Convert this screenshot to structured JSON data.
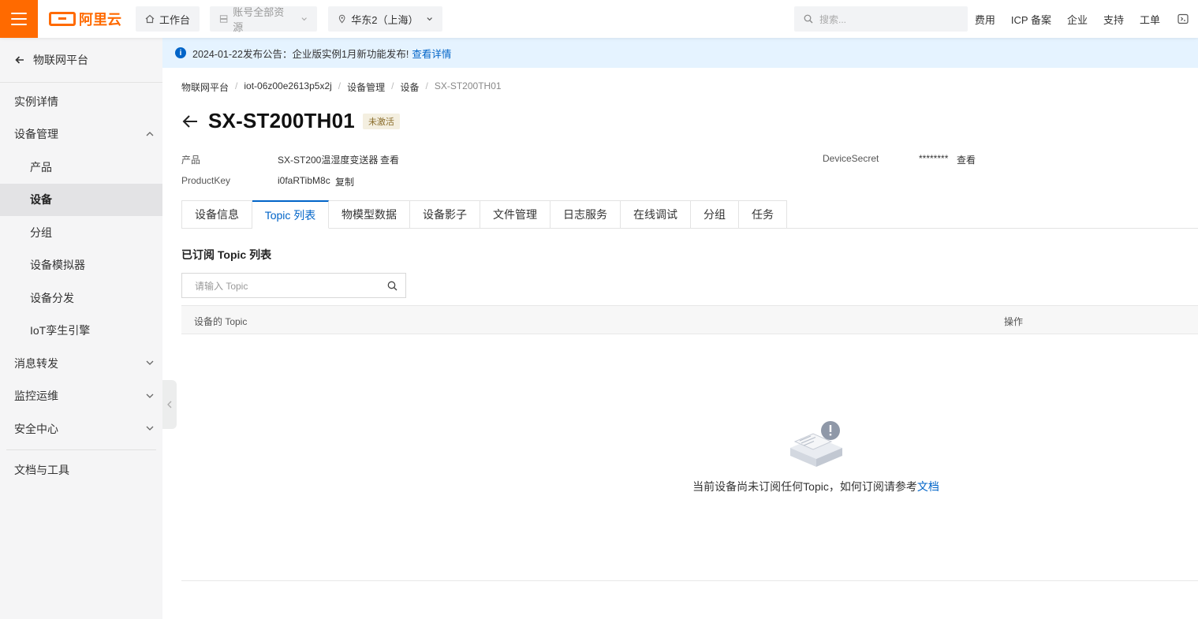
{
  "brand": {
    "logo_text": "阿里云",
    "accent": "#ff6a00",
    "link_color": "#0064c8"
  },
  "topbar": {
    "workbench": "工作台",
    "resources": "账号全部资源",
    "region": "华东2（上海）",
    "search_placeholder": "搜索...",
    "links": [
      "费用",
      "ICP 备案",
      "企业",
      "支持",
      "工单"
    ]
  },
  "sidebar": {
    "back_label": "物联网平台",
    "items": [
      {
        "label": "实例详情"
      },
      {
        "label": "设备管理"
      },
      {
        "label": "产品"
      },
      {
        "label": "设备"
      },
      {
        "label": "分组"
      },
      {
        "label": "设备模拟器"
      },
      {
        "label": "设备分发"
      },
      {
        "label": "IoT孪生引擎"
      },
      {
        "label": "消息转发"
      },
      {
        "label": "监控运维"
      },
      {
        "label": "安全中心"
      },
      {
        "label": "文档与工具"
      }
    ]
  },
  "notice": {
    "text": "2024-01-22发布公告：企业版实例1月新功能发布!",
    "link": "查看详情"
  },
  "breadcrumb": [
    "物联网平台",
    "iot-06z00e2613p5x2j",
    "设备管理",
    "设备",
    "SX-ST200TH01"
  ],
  "device": {
    "name": "SX-ST200TH01",
    "status": "未激活",
    "product_label": "产品",
    "product_value": "SX-ST200温湿度变送器",
    "product_link": "查看",
    "productkey_label": "ProductKey",
    "productkey_value": "i0faRTibM8c",
    "productkey_link": "复制",
    "secret_label": "DeviceSecret",
    "secret_value": "********",
    "secret_link": "查看"
  },
  "tabs": [
    "设备信息",
    "Topic 列表",
    "物模型数据",
    "设备影子",
    "文件管理",
    "日志服务",
    "在线调试",
    "分组",
    "任务"
  ],
  "topic_section": {
    "title": "已订阅 Topic 列表",
    "search_placeholder": "请输入 Topic",
    "col_topic": "设备的 Topic",
    "col_action": "操作",
    "empty_text": "当前设备尚未订阅任何Topic，如何订阅请参考",
    "empty_link": "文档"
  }
}
